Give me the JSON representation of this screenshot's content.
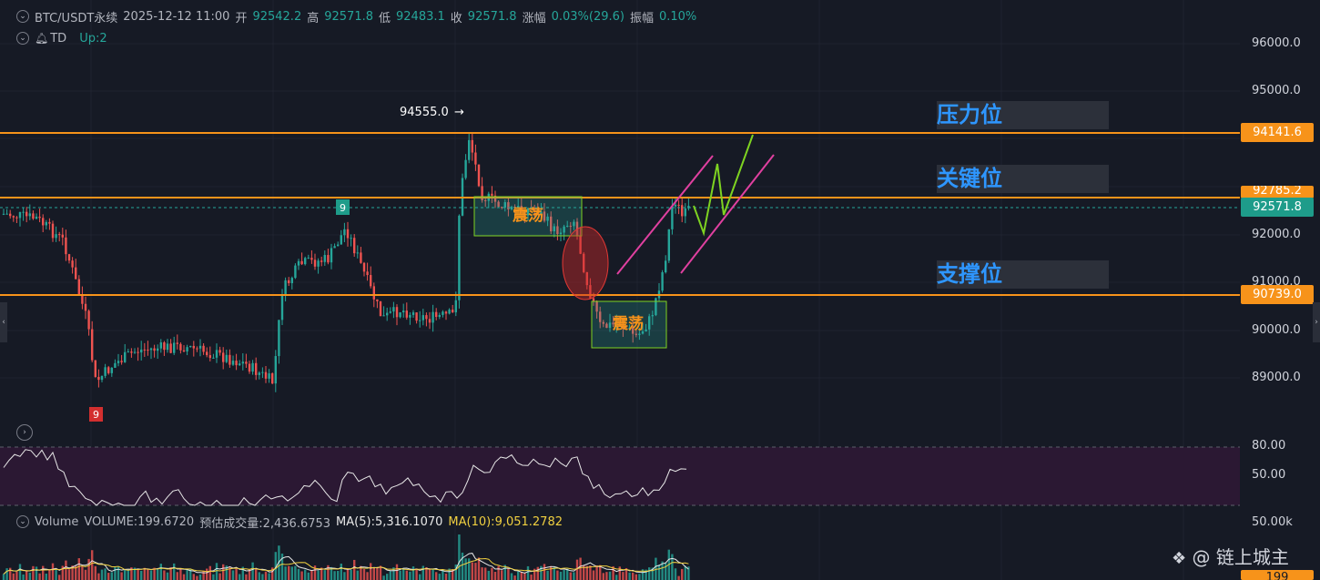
{
  "header": {
    "symbol": "BTC/USDT永续",
    "datetime": "2025-12-12 11:00",
    "open_label": "开",
    "open": "92542.2",
    "high_label": "高",
    "high": "92571.8",
    "low_label": "低",
    "low": "92483.1",
    "close_label": "收",
    "close": "92571.8",
    "change_label": "涨幅",
    "change": "0.03%(29.6)",
    "amplitude_label": "振幅",
    "amplitude": "0.10%"
  },
  "indicator_td": {
    "name": "TD",
    "value_label": "Up:2"
  },
  "price_axis": {
    "ticks": [
      "96000.0",
      "95000.0",
      "92000.0",
      "91000.0",
      "90000.0",
      "89000.0"
    ],
    "tag_resistance": "94141.6",
    "tag_key_hidden": "92785.2",
    "tag_current": "92571.8",
    "tag_support": "90739.0"
  },
  "annotations": {
    "resistance_label": "压力位",
    "key_label": "关键位",
    "support_label": "支撑位",
    "range_label_1": "震荡",
    "range_label_2": "震荡",
    "peak_label": "94555.0",
    "td_count_high": "9",
    "td_count_low": "9"
  },
  "rsi": {
    "ticks": [
      "80.00",
      "50.00"
    ]
  },
  "volume": {
    "label": "Volume",
    "volume_value": "VOLUME:199.6720",
    "estimate": "预估成交量:2,436.6753",
    "ma5": "MA(5):5,316.1070",
    "ma10": "MA(10):9,051.2782",
    "axis_top": "50.00k",
    "axis_current": "199"
  },
  "watermark": "@ 链上城主",
  "colors": {
    "background": "#161a25",
    "up": "#26a69a",
    "down": "#ef5350",
    "level_line": "#f7931a",
    "zone_text": "#2e96ff",
    "channel": "#e040a0",
    "projection": "#7ed321",
    "rsi_band": "#2b1833",
    "ma5": "#e8e8e8",
    "ma10": "#f0d040"
  },
  "chart_data": {
    "type": "candlestick",
    "y_range": [
      88000,
      96500
    ],
    "levels": {
      "resistance": 94141.6,
      "key": 92785.2,
      "current": 92571.8,
      "support": 90739.0
    },
    "peak_high": 94555.0
  }
}
